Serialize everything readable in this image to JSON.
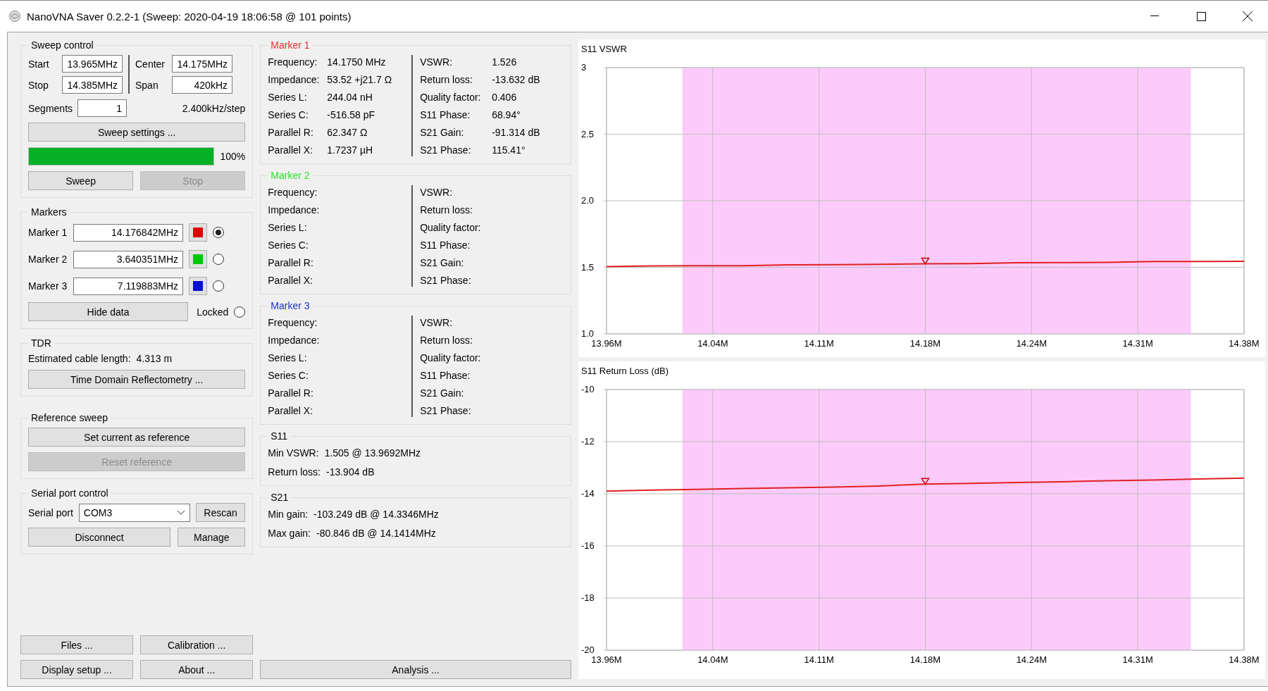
{
  "window": {
    "title": "NanoVNA Saver 0.2.2-1 (Sweep: 2020-04-19 18:06:58 @ 101 points)"
  },
  "sweep_control": {
    "title": "Sweep control",
    "fields": [
      {
        "label": "Start",
        "value": "13.965MHz"
      },
      {
        "label": "Center",
        "value": "14.175MHz"
      },
      {
        "label": "Stop",
        "value": "14.385MHz"
      },
      {
        "label": "Span",
        "value": "420kHz"
      }
    ],
    "segments": {
      "label": "Segments",
      "value": "1"
    },
    "step": "2.400kHz/step",
    "settings_button": "Sweep settings ...",
    "progress": {
      "level": 1,
      "reading": "100%"
    },
    "buttons": [
      {
        "label": "Sweep",
        "disabled": false
      },
      {
        "label": "Stop",
        "disabled": true
      }
    ]
  },
  "markers": {
    "title": "Markers",
    "items": [
      {
        "label": "Marker 1",
        "value": "14.176842MHz",
        "color": "#e00000",
        "selected": true
      },
      {
        "label": "Marker 2",
        "value": "3.640351MHz",
        "color": "#00c800",
        "selected": false
      },
      {
        "label": "Marker 3",
        "value": "7.119883MHz",
        "color": "#0010d0",
        "selected": false
      }
    ],
    "hide_button": "Hide data",
    "locked": {
      "label": "Locked",
      "checked": false
    }
  },
  "tdr": {
    "title": "TDR",
    "label": "Estimated cable length:",
    "value": "4.313 m",
    "button": "Time Domain Reflectometry ..."
  },
  "reference_sweep": {
    "title": "Reference sweep",
    "buttons": [
      {
        "label": "Set current as reference",
        "disabled": false
      },
      {
        "label": "Reset reference",
        "disabled": true
      }
    ]
  },
  "serial_port": {
    "title": "Serial port control",
    "label": "Serial port",
    "value": "COM3",
    "buttons": [
      "Rescan",
      "Disconnect",
      "Manage"
    ]
  },
  "bottom_buttons": [
    "Files ...",
    "Calibration ...",
    "Display setup ...",
    "About ..."
  ],
  "marker_details": [
    {
      "title": "Marker 1",
      "color": "#e03030",
      "left": [
        {
          "label": "Frequency:",
          "value": "14.1750 MHz"
        },
        {
          "label": "Impedance:",
          "value": "53.52 +j21.7 Ω"
        },
        {
          "label": "Series L:",
          "value": "244.04 nH"
        },
        {
          "label": "Series C:",
          "value": "-516.58 pF"
        },
        {
          "label": "Parallel R:",
          "value": "62.347 Ω"
        },
        {
          "label": "Parallel X:",
          "value": "1.7237 µH"
        }
      ],
      "right": [
        {
          "label": "VSWR:",
          "value": "1.526"
        },
        {
          "label": "Return loss:",
          "value": "-13.632 dB"
        },
        {
          "label": "Quality factor:",
          "value": "0.406"
        },
        {
          "label": "S11 Phase:",
          "value": "68.94°"
        },
        {
          "label": "S21 Gain:",
          "value": "-91.314 dB"
        },
        {
          "label": "S21 Phase:",
          "value": "115.41°"
        }
      ]
    },
    {
      "title": "Marker 2",
      "color": "#30e030",
      "left": [
        {
          "label": "Frequency:"
        },
        {
          "label": "Impedance:"
        },
        {
          "label": "Series L:"
        },
        {
          "label": "Series C:"
        },
        {
          "label": "Parallel R:"
        },
        {
          "label": "Parallel X:"
        }
      ],
      "right": [
        {
          "label": "VSWR:"
        },
        {
          "label": "Return loss:"
        },
        {
          "label": "Quality factor:"
        },
        {
          "label": "S11 Phase:"
        },
        {
          "label": "S21 Gain:"
        },
        {
          "label": "S21 Phase:"
        }
      ]
    },
    {
      "title": "Marker 3",
      "color": "#2030c0",
      "left": [
        {
          "label": "Frequency:"
        },
        {
          "label": "Impedance:"
        },
        {
          "label": "Series L:"
        },
        {
          "label": "Series C:"
        },
        {
          "label": "Parallel R:"
        },
        {
          "label": "Parallel X:"
        }
      ],
      "right": [
        {
          "label": "VSWR:"
        },
        {
          "label": "Return loss:"
        },
        {
          "label": "Quality factor:"
        },
        {
          "label": "S11 Phase:"
        },
        {
          "label": "S21 Gain:"
        },
        {
          "label": "S21 Phase:"
        }
      ]
    }
  ],
  "s11": {
    "title": "S11",
    "rows": [
      {
        "label": "Min VSWR:",
        "value": "1.505 @ 13.9692MHz"
      },
      {
        "label": "Return loss:",
        "value": "-13.904 dB"
      }
    ]
  },
  "s21": {
    "title": "S21",
    "rows": [
      {
        "label": "Min gain:",
        "value": "-103.249 dB @ 14.3346MHz"
      },
      {
        "label": "Max gain:",
        "value": "-80.846 dB @ 14.1414MHz"
      }
    ]
  },
  "analysis_button": "Analysis ...",
  "charts": [
    {
      "chart_data": {
        "type": "line",
        "title": "S11 VSWR",
        "x": [
          13.965,
          13.995,
          14.025,
          14.055,
          14.085,
          14.115,
          14.145,
          14.175,
          14.205,
          14.235,
          14.265,
          14.295,
          14.325,
          14.355,
          14.385
        ],
        "grid": true,
        "series": [
          {
            "color": "#e02020",
            "values": [
              1.505,
              1.51,
              1.512,
              1.512,
              1.518,
              1.52,
              1.522,
              1.526,
              1.528,
              1.534,
              1.536,
              1.537,
              1.543,
              1.544,
              1.545
            ]
          }
        ],
        "xlim": [
          13.965,
          14.385
        ],
        "ylim": [
          1.0,
          3.0
        ],
        "xticks": [
          {
            "value": 13.965,
            "label": "13.96M"
          },
          {
            "value": 14.035,
            "label": "14.04M"
          },
          {
            "value": 14.105,
            "label": "14.11M"
          },
          {
            "value": 14.175,
            "label": "14.18M"
          },
          {
            "value": 14.245,
            "label": "14.24M"
          },
          {
            "value": 14.315,
            "label": "14.31M"
          },
          {
            "value": 14.385,
            "label": "14.38M"
          }
        ],
        "yticks": [
          {
            "value": 1.0,
            "label": "1.0"
          },
          {
            "value": 1.5,
            "label": "1.5"
          },
          {
            "value": 2.0,
            "label": "2.0"
          },
          {
            "value": 2.5,
            "label": "2.5"
          },
          {
            "value": 3.0,
            "label": "3"
          }
        ],
        "bands": [
          {
            "axis": "x",
            "from": 14.015,
            "to": 14.35
          }
        ]
      }
    },
    {
      "chart_data": {
        "type": "line",
        "title": "S11 Return Loss (dB)",
        "x": [
          13.965,
          13.995,
          14.025,
          14.055,
          14.085,
          14.115,
          14.145,
          14.175,
          14.205,
          14.235,
          14.265,
          14.295,
          14.325,
          14.355,
          14.385
        ],
        "grid": true,
        "series": [
          {
            "color": "#e02020",
            "values": [
              -13.9,
              -13.86,
              -13.83,
              -13.8,
              -13.77,
              -13.74,
              -13.7,
              -13.63,
              -13.6,
              -13.57,
              -13.54,
              -13.5,
              -13.47,
              -13.43,
              -13.4
            ]
          }
        ],
        "xlim": [
          13.965,
          14.385
        ],
        "ylim": [
          -20,
          -10
        ],
        "xticks": [
          {
            "value": 13.965,
            "label": "13.96M"
          },
          {
            "value": 14.035,
            "label": "14.04M"
          },
          {
            "value": 14.105,
            "label": "14.11M"
          },
          {
            "value": 14.175,
            "label": "14.18M"
          },
          {
            "value": 14.245,
            "label": "14.24M"
          },
          {
            "value": 14.315,
            "label": "14.31M"
          },
          {
            "value": 14.385,
            "label": "14.38M"
          }
        ],
        "yticks": [
          -20,
          -18,
          -16,
          -14,
          -12,
          -10
        ],
        "bands": [
          {
            "axis": "x",
            "from": 14.015,
            "to": 14.35
          }
        ]
      }
    }
  ]
}
